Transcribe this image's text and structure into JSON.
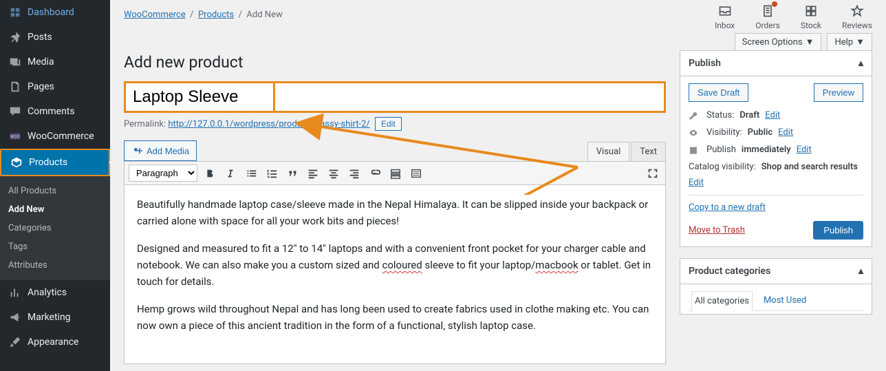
{
  "sidebar": {
    "items": [
      {
        "label": "Dashboard",
        "icon": "dashboard-icon"
      },
      {
        "label": "Posts",
        "icon": "pin-icon"
      },
      {
        "label": "Media",
        "icon": "media-icon"
      },
      {
        "label": "Pages",
        "icon": "page-icon"
      },
      {
        "label": "Comments",
        "icon": "comment-icon"
      },
      {
        "label": "WooCommerce",
        "icon": "woo-icon"
      },
      {
        "label": "Products",
        "icon": "box-icon"
      },
      {
        "label": "Analytics",
        "icon": "chart-icon"
      },
      {
        "label": "Marketing",
        "icon": "megaphone-icon"
      },
      {
        "label": "Appearance",
        "icon": "brush-icon"
      }
    ],
    "submenu": [
      "All Products",
      "Add New",
      "Categories",
      "Tags",
      "Attributes"
    ]
  },
  "breadcrumb": {
    "items": [
      "WooCommerce",
      "Products"
    ],
    "current": "Add New"
  },
  "top_icons": [
    {
      "label": "Inbox",
      "icon": "inbox-icon"
    },
    {
      "label": "Orders",
      "icon": "orders-icon",
      "badge": true
    },
    {
      "label": "Stock",
      "icon": "grid-icon"
    },
    {
      "label": "Reviews",
      "icon": "star-icon"
    }
  ],
  "meta_tabs": {
    "screen_options": "Screen Options",
    "help": "Help"
  },
  "page": {
    "title": "Add new product",
    "product_title": "Laptop Sleeve"
  },
  "permalink": {
    "label": "Permalink:",
    "base": "http://127.0.0.1/wordpress/product/",
    "slug": "classy-shirt-2/",
    "edit": "Edit"
  },
  "add_media": "Add Media",
  "editor_tabs": {
    "visual": "Visual",
    "text": "Text"
  },
  "format_select": "Paragraph",
  "body": {
    "p1": "Beautifully handmade laptop case/sleeve made in the Nepal Himalaya. It can be slipped inside your backpack or carried alone with space for all your work bits and pieces!",
    "p2_a": "Designed and measured to fit a 12\" to 14\" laptops and with a convenient front pocket for your charger cable and notebook. We can also make you a custom sized and ",
    "p2_b": "coloured",
    "p2_c": " sleeve to fit your laptop/",
    "p2_d": "macbook",
    "p2_e": " or tablet. Get in touch for details.",
    "p3": "Hemp grows wild throughout Nepal and has long been used to create fabrics used in clothe making etc. You can now own a piece of this ancient tradition in the form of a functional, stylish laptop case."
  },
  "publish": {
    "title": "Publish",
    "save_draft": "Save Draft",
    "preview": "Preview",
    "status_label": "Status:",
    "status_value": "Draft",
    "edit": "Edit",
    "visibility_label": "Visibility:",
    "visibility_value": "Public",
    "publish_label": "Publish",
    "publish_value": "immediately",
    "catalog_label": "Catalog visibility:",
    "catalog_value": "Shop and search results",
    "copy_link": "Copy to a new draft",
    "trash_link": "Move to Trash",
    "publish_btn": "Publish"
  },
  "categories": {
    "title": "Product categories",
    "tab_all": "All categories",
    "tab_most": "Most Used"
  }
}
